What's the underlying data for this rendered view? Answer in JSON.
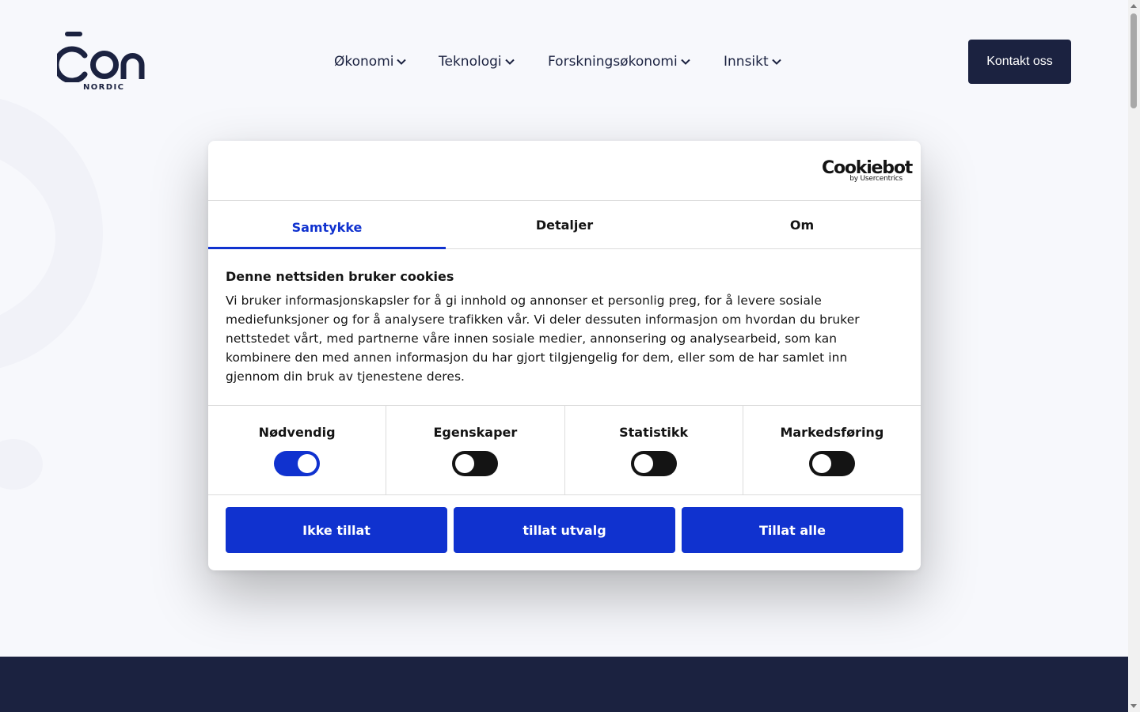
{
  "header": {
    "logo_text": "con",
    "logo_sub": "NORDIC",
    "nav": [
      {
        "label": "Økonomi"
      },
      {
        "label": "Teknologi"
      },
      {
        "label": "Forskningsøkonomi"
      },
      {
        "label": "Innsikt"
      }
    ],
    "contact_label": "Kontakt oss"
  },
  "dialog": {
    "brand": {
      "word": "Cookiebot",
      "by": "by Usercentrics"
    },
    "tabs": [
      {
        "label": "Samtykke",
        "active": true
      },
      {
        "label": "Detaljer",
        "active": false
      },
      {
        "label": "Om",
        "active": false
      }
    ],
    "title": "Denne nettsiden bruker cookies",
    "text": "Vi bruker informasjonskapsler for å gi innhold og annonser et personlig preg, for å levere sosiale mediefunksjoner og for å analysere trafikken vår. Vi deler dessuten informasjon om hvordan du bruker nettstedet vårt, med partnerne våre innen sosiale medier, annonsering og analysearbeid, som kan kombinere den med annen informasjon du har gjort tilgjengelig for dem, eller som de har samlet inn gjennom din bruk av tjenestene deres.",
    "toggles": [
      {
        "label": "Nødvendig",
        "on": true
      },
      {
        "label": "Egenskaper",
        "on": false
      },
      {
        "label": "Statistikk",
        "on": false
      },
      {
        "label": "Markedsføring",
        "on": false
      }
    ],
    "buttons": {
      "deny": "Ikke tillat",
      "selection": "tillat utvalg",
      "allow_all": "Tillat alle"
    }
  },
  "colors": {
    "brand_dark": "#1b2240",
    "accent_blue": "#1032cf"
  }
}
